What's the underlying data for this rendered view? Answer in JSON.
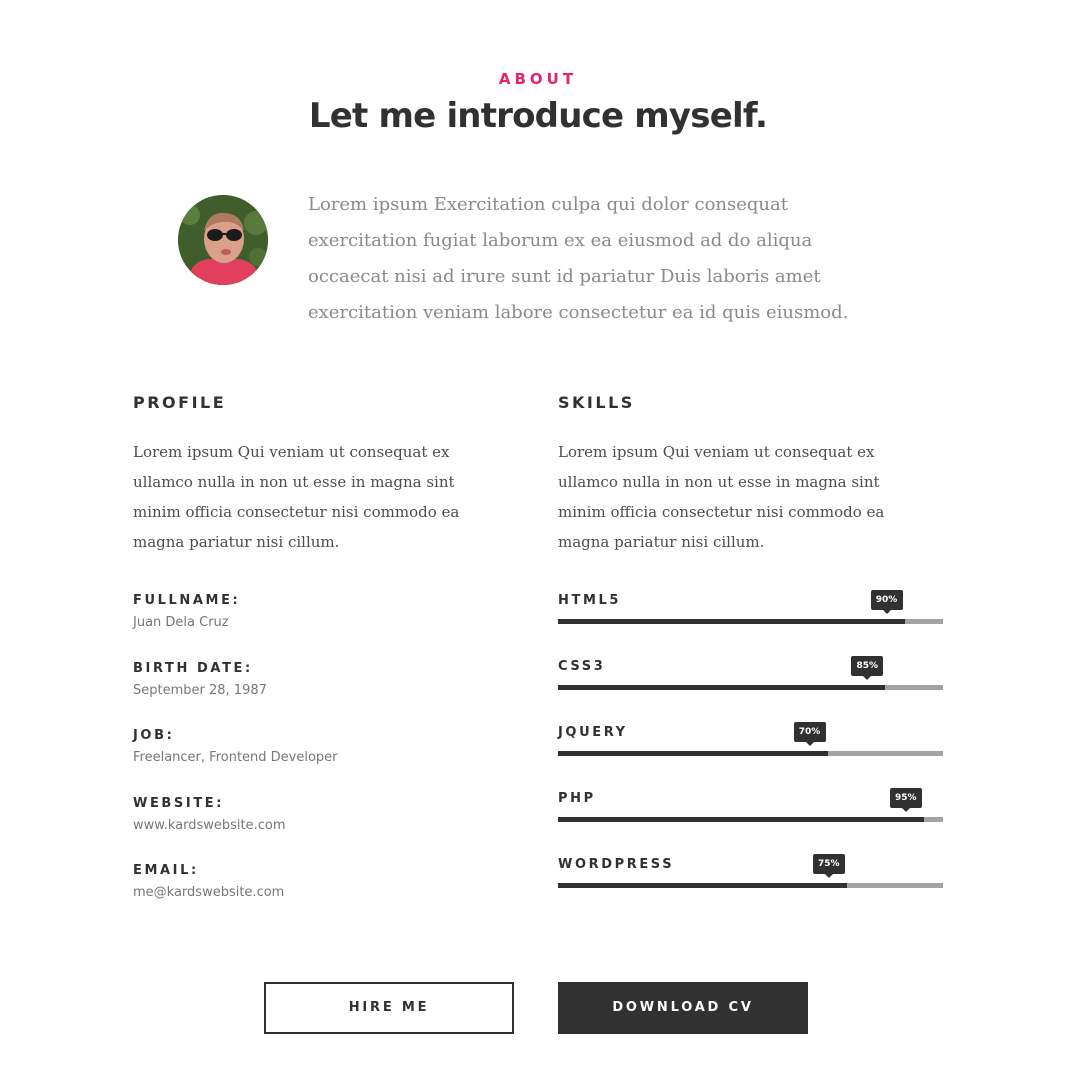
{
  "header": {
    "eyebrow": "ABOUT",
    "title": "Let me introduce myself."
  },
  "intro": {
    "text": "Lorem ipsum Exercitation culpa qui dolor consequat exercitation fugiat laborum ex ea eiusmod ad do aliqua occaecat nisi ad irure sunt id pariatur Duis laboris amet exercitation veniam labore consectetur ea id quis eiusmod."
  },
  "profile": {
    "title": "PROFILE",
    "text": "Lorem ipsum Qui veniam ut consequat ex ullamco nulla in non ut esse in magna sint minim officia consectetur nisi commodo ea magna pariatur nisi cillum.",
    "info": [
      {
        "label": "FULLNAME:",
        "value": "Juan Dela Cruz"
      },
      {
        "label": "BIRTH DATE:",
        "value": "September 28, 1987"
      },
      {
        "label": "JOB:",
        "value": "Freelancer, Frontend Developer"
      },
      {
        "label": "WEBSITE:",
        "value": "www.kardswebsite.com"
      },
      {
        "label": "EMAIL:",
        "value": "me@kardswebsite.com"
      }
    ]
  },
  "skills": {
    "title": "SKILLS",
    "text": "Lorem ipsum Qui veniam ut consequat ex ullamco nulla in non ut esse in magna sint minim officia consectetur nisi commodo ea magna pariatur nisi cillum.",
    "items": [
      {
        "name": "HTML5",
        "percent": 90,
        "label": "90%"
      },
      {
        "name": "CSS3",
        "percent": 85,
        "label": "85%"
      },
      {
        "name": "JQUERY",
        "percent": 70,
        "label": "70%"
      },
      {
        "name": "PHP",
        "percent": 95,
        "label": "95%"
      },
      {
        "name": "WORDPRESS",
        "percent": 75,
        "label": "75%"
      }
    ]
  },
  "buttons": {
    "hire": "HIRE ME",
    "download": "DOWNLOAD CV"
  },
  "colors": {
    "accent": "#e8216e",
    "dark": "#313131",
    "track": "#a3a3a3"
  }
}
